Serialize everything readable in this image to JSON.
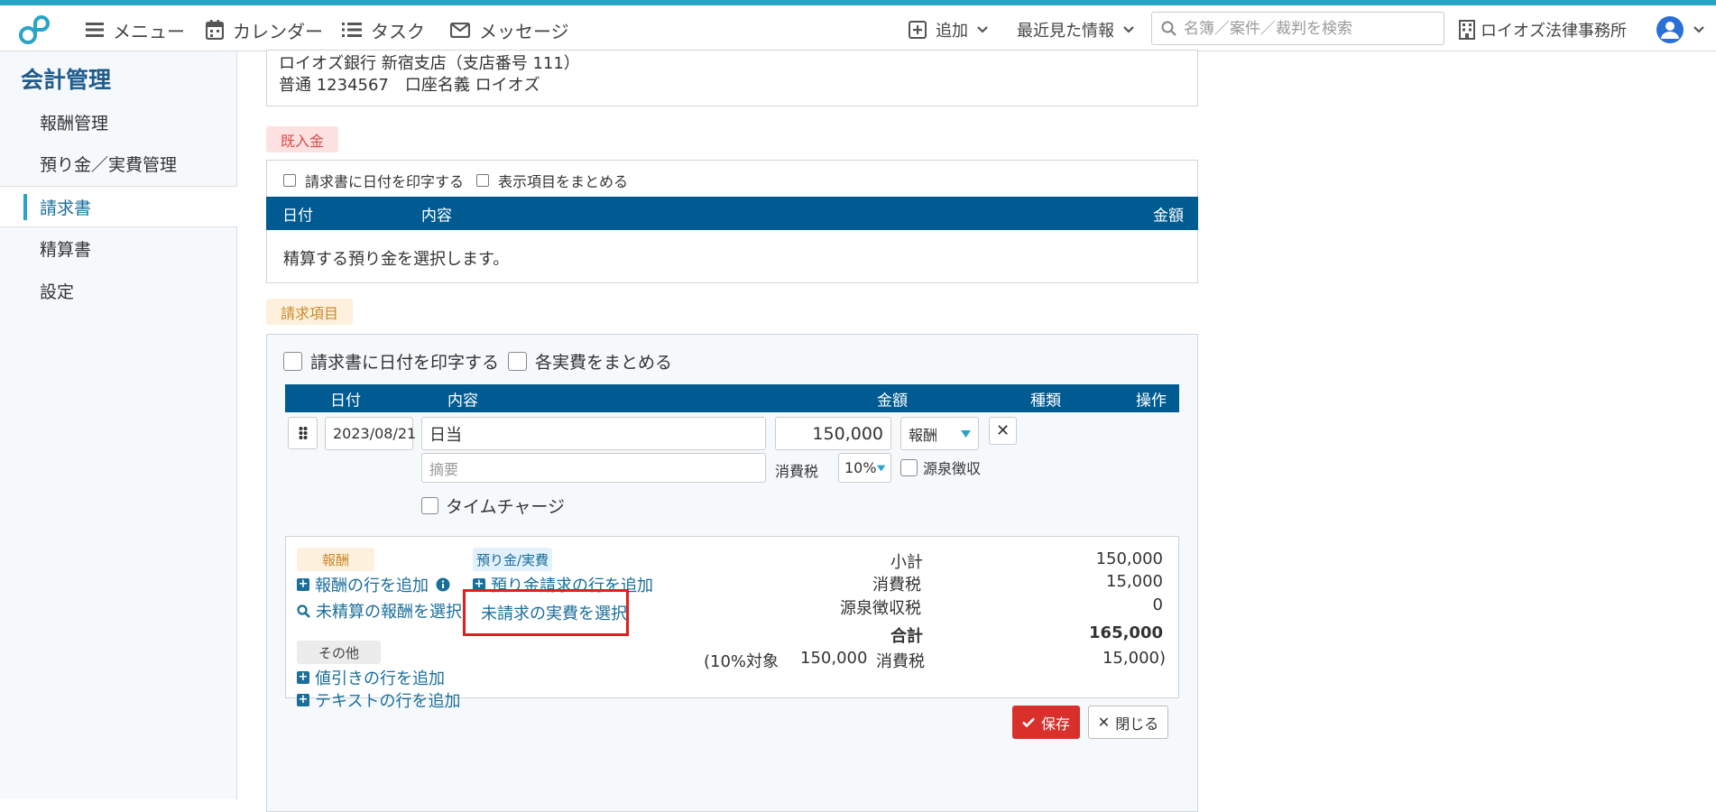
{
  "header": {
    "menu": "メニュー",
    "calendar": "カレンダー",
    "task": "タスク",
    "message": "メッセージ",
    "add": "追加",
    "recent": "最近見た情報",
    "search_placeholder": "名簿／案件／裁判を検索",
    "office": "ロイオズ法律事務所"
  },
  "sidebar": {
    "title": "会計管理",
    "items": [
      {
        "label": "報酬管理"
      },
      {
        "label": "預り金／実費管理"
      },
      {
        "label": "請求書"
      },
      {
        "label": "精算書"
      },
      {
        "label": "設定"
      }
    ],
    "active_index": 2
  },
  "bank": {
    "line1": "ロイオズ銀行 新宿支店（支店番号 111）",
    "line2": "普通 1234567　口座名義 ロイオズ"
  },
  "received": {
    "badge": "既入金",
    "opt_date": "請求書に日付を印字する",
    "opt_group": "表示項目をまとめる",
    "cols": {
      "date": "日付",
      "content": "内容",
      "amount": "金額"
    },
    "empty": "精算する預り金を選択します。"
  },
  "items": {
    "badge": "請求項目",
    "opt_date": "請求書に日付を印字する",
    "opt_group": "各実費をまとめる",
    "cols": {
      "date": "日付",
      "content": "内容",
      "amount": "金額",
      "kind": "種類",
      "op": "操作"
    },
    "row": {
      "date": "2023/08/21",
      "content": "日当",
      "summary_placeholder": "摘要",
      "amount": "150,000",
      "kind": "報酬",
      "tax_label": "消費税",
      "tax_rate": "10%",
      "withholding": "源泉徴収",
      "timecharge": "タイムチャージ"
    }
  },
  "actions": {
    "fee_badge": "報酬",
    "fee_add": "報酬の行を追加",
    "fee_select": "未精算の報酬を選択",
    "other_badge": "その他",
    "discount_add": "値引きの行を追加",
    "text_add": "テキストの行を追加",
    "deposit_badge": "預り金/実費",
    "deposit_add": "預り金請求の行を追加",
    "expense_select": "未請求の実費を選択"
  },
  "summary": {
    "subtotal_label": "小計",
    "subtotal": "150,000",
    "tax_label": "消費税",
    "tax": "15,000",
    "withholding_label": "源泉徴収税",
    "withholding": "0",
    "total_label": "合計",
    "total": "165,000",
    "target_label": "(10%対象",
    "target": "150,000",
    "target_tax_label": "消費税",
    "target_tax": "15,000)"
  },
  "buttons": {
    "save": "保存",
    "close": "閉じる"
  },
  "colors": {
    "accent": "#005b93",
    "link": "#1a6e9a",
    "save": "#d9302c",
    "highlight": "#e02020"
  }
}
